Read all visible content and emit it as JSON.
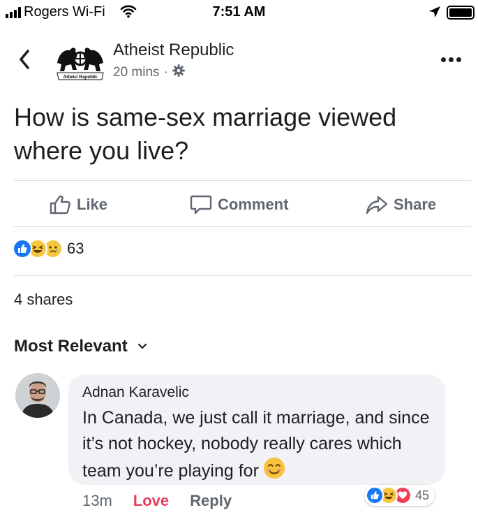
{
  "status_bar": {
    "carrier": "Rogers Wi-Fi",
    "time": "7:51 AM",
    "icons": [
      "signal-bars-icon",
      "wifi-icon",
      "location-arrow-icon",
      "battery-icon"
    ]
  },
  "post": {
    "page_name": "Atheist Republic",
    "avatar_logo_text": "Atheist Republic",
    "posted": "20 mins",
    "separator": "·",
    "audience_icon": "gear-icon",
    "text": "How is same-sex marriage viewed where you live?"
  },
  "actions": {
    "like": "Like",
    "comment": "Comment",
    "share": "Share"
  },
  "reactions": {
    "types": [
      "like",
      "haha",
      "sad"
    ],
    "count": "63"
  },
  "shares": "4 shares",
  "comments_sort": {
    "label": "Most Relevant",
    "icon": "chevron-down-icon"
  },
  "comment": {
    "author": "Adnan Karavelic",
    "text": "In Canada, we just call it marriage, and since it’s not hockey, nobody really cares which team you’re playing for",
    "emoji": "smiling-face",
    "time": "13m",
    "love_label": "Love",
    "reply_label": "Reply",
    "reaction_types": [
      "like",
      "haha",
      "love"
    ],
    "reaction_count": "45"
  },
  "colors": {
    "brand_blue": "#1877f2",
    "love_red": "#e4405f",
    "bubble_bg": "#f0f2f5",
    "secondary_text": "#606770"
  }
}
